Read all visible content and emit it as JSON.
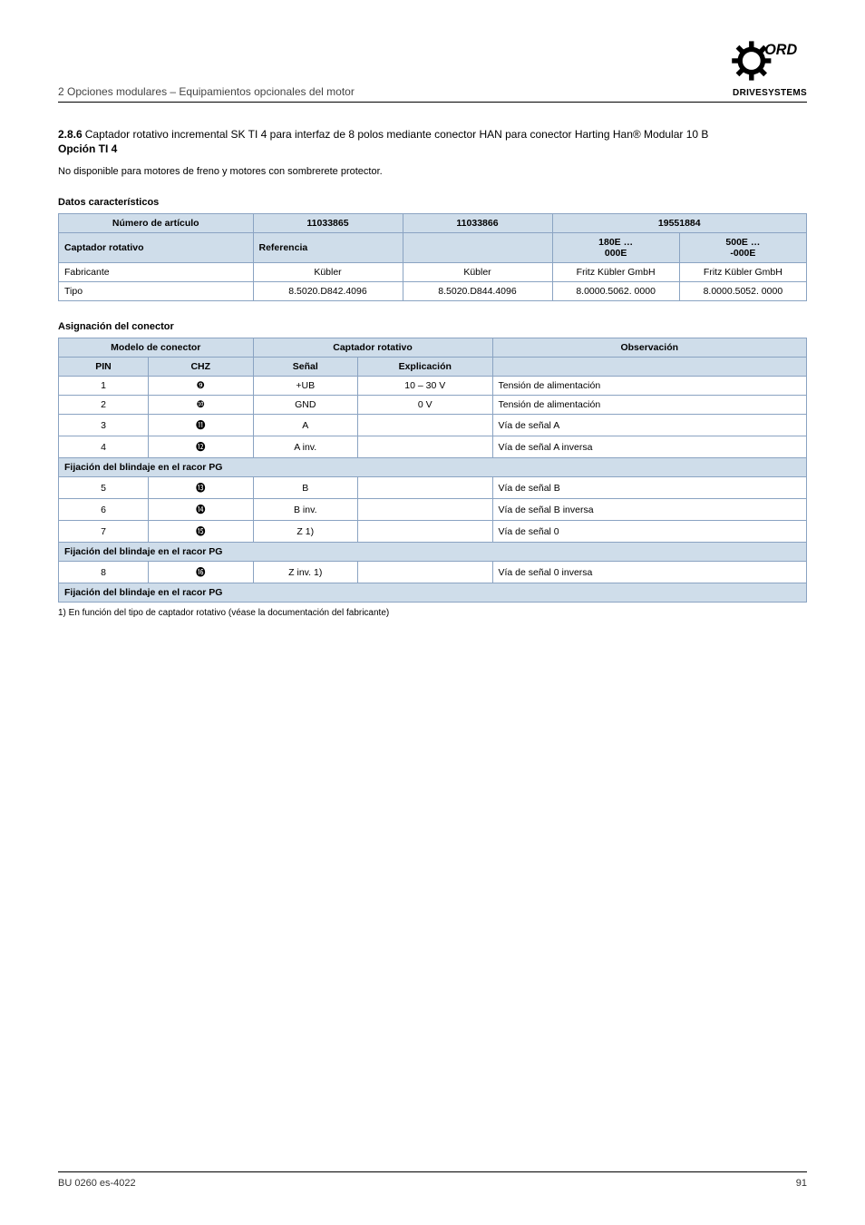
{
  "header": {
    "title": "2 Opciones modulares – Equipamientos opcionales del motor"
  },
  "logo": {
    "brand_text": "NORD",
    "sub": "DRIVESYSTEMS"
  },
  "section": {
    "number": "2.8.6",
    "title": "Captador rotativo incremental SK TI 4 para interfaz de 8 polos mediante conector HAN para conector Harting Han® Modular 10 B",
    "option": "Opción TI 4",
    "availability": "No disponible para motores de freno y motores con sombrerete protector."
  },
  "table1": {
    "headers": {
      "c1": "Número de artículo",
      "c2": "11033865",
      "c3": "11033866",
      "c4": "19551884",
      "sub_left": "180E …\n000E",
      "sub_right": "500E …\n-000E"
    },
    "row_captador_label": "Captador rotativo",
    "row_ref_label": "Referencia",
    "rows": [
      {
        "label": "Fabricante",
        "v1": "Kübler",
        "v2": "Kübler",
        "v3": "Fritz Kübler GmbH",
        "v4": "Fritz Kübler GmbH"
      },
      {
        "label": "Tipo",
        "v1": "8.5020.D842.4096",
        "v2": "8.5020.D844.4096",
        "v3": "8.0000.5062. 0000",
        "v4": "8.0000.5052. 0000"
      }
    ]
  },
  "table2": {
    "headers": {
      "connector": "Modelo de conector",
      "captador": "Captador rotativo",
      "remark": "Observación"
    },
    "sub": {
      "pin": "PIN",
      "chz": "CHZ",
      "senal": "Señal",
      "expl": "Explicación"
    },
    "rows": [
      {
        "pin": "1",
        "chz": "❾",
        "senal": "+UB",
        "expl": "10 – 30 V",
        "obs": "Tensión de alimentación"
      },
      {
        "pin": "2",
        "chz": "❿",
        "senal": "GND",
        "expl": "0 V",
        "obs": "Tensión de alimentación"
      },
      {
        "pin": "3",
        "chz": "⓫",
        "senal": "A",
        "expl": "",
        "obs": "Vía de señal A"
      },
      {
        "pin": "4",
        "chz": "⓬",
        "senal": "A inv.",
        "expl": "",
        "obs": "Vía de señal A inversa"
      }
    ],
    "band1": "Fijación del blindaje en el racor PG",
    "rows2": [
      {
        "pin": "5",
        "chz": "⓭",
        "senal": "B",
        "expl": "",
        "obs": "Vía de señal B"
      },
      {
        "pin": "6",
        "chz": "⓮",
        "senal": "B inv.",
        "expl": "",
        "obs": "Vía de señal B inversa"
      },
      {
        "pin": "7",
        "chz": "⓯",
        "senal": "Z 1)",
        "expl": "",
        "obs": "Vía de señal 0"
      }
    ],
    "band2": "Fijación del blindaje en el racor PG",
    "rows3": [
      {
        "pin": "8",
        "chz": "⓰",
        "senal": "Z inv. 1)",
        "expl": "",
        "obs": "Vía de señal 0 inversa"
      }
    ],
    "band3": "Fijación del blindaje en el racor PG"
  },
  "footnotes": {
    "f1": "1) En función del tipo de captador rotativo (véase la documentación del fabricante)"
  },
  "footer": {
    "doc": "BU 0260 es-4022",
    "page": "91"
  }
}
